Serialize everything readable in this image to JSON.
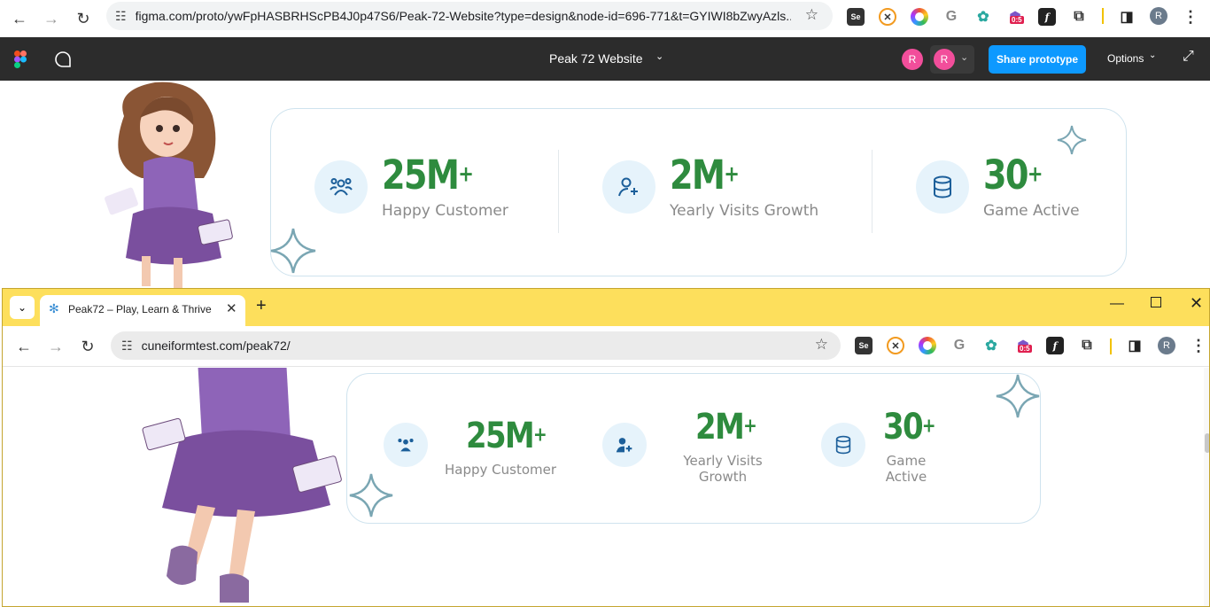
{
  "top_browser": {
    "url": "figma.com/proto/ywFpHASBRHScPB4J0p47S6/Peak-72-Website?type=design&node-id=696-771&t=GYIWI8bZwyAzls...",
    "profile_initial": "R",
    "badge_count": "0:5"
  },
  "figma": {
    "file_title": "Peak 72 Website",
    "avatar_1": "R",
    "avatar_2": "R",
    "share_label": "Share prototype",
    "options_label": "Options"
  },
  "stats_design": {
    "items": [
      {
        "number": "25M",
        "suffix": "+",
        "label": "Happy Customer",
        "icon": "users-icon"
      },
      {
        "number": "2M",
        "suffix": "+",
        "label": "Yearly Visits Growth",
        "icon": "user-plus-icon"
      },
      {
        "number": "30",
        "suffix": "+",
        "label": "Game Active",
        "icon": "database-icon"
      }
    ]
  },
  "bottom_browser": {
    "tab_title": "Peak72 – Play, Learn & Thrive",
    "url": "cuneiformtest.com/peak72/",
    "profile_initial": "R",
    "badge_count": "0:5"
  },
  "stats_live": {
    "items": [
      {
        "number": "25M",
        "suffix": "+",
        "label": "Happy Customer"
      },
      {
        "number": "2M",
        "suffix": "+",
        "label_line1": "Yearly Visits",
        "label_line2": "Growth"
      },
      {
        "number": "30",
        "suffix": "+",
        "label_line1": "Game",
        "label_line2": "Active"
      }
    ]
  },
  "colors": {
    "accent_green": "#2e8b3e",
    "figma_blue": "#0d99ff",
    "tab_yellow": "#fddf5c",
    "sparkle": "#7aa6b3"
  }
}
